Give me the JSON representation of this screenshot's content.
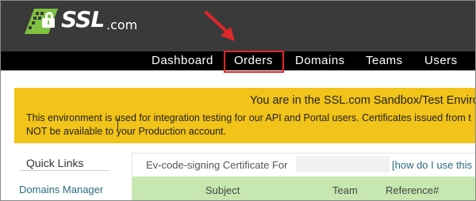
{
  "brand": {
    "name": "SSL",
    "suffix": ".com"
  },
  "nav": {
    "items": [
      {
        "label": "Dashboard"
      },
      {
        "label": "Orders"
      },
      {
        "label": "Domains"
      },
      {
        "label": "Teams"
      },
      {
        "label": "Users"
      }
    ],
    "highlighted": "Orders"
  },
  "banner": {
    "title": "You are in the SSL.com Sandbox/Test Environn",
    "line1": "This environment is used for integration testing for our API and Portal users. Certificates issued from t",
    "line2": "NOT be available to your Production account."
  },
  "sidebar": {
    "title": "Quick Links",
    "items": [
      {
        "label": "Domains Manager"
      }
    ]
  },
  "main": {
    "cert_label": "Ev-code-signing Certificate For",
    "help_link": "[how do I use this",
    "table_headers": [
      "Subject",
      "Team",
      "Reference#"
    ]
  },
  "colors": {
    "header_bg": "#3a3a3a",
    "nav_bg": "#000000",
    "banner_bg": "#f2c318",
    "table_header_bg": "#c6e8b0",
    "highlight": "#e0272b",
    "logo_green": "#7fc241"
  }
}
